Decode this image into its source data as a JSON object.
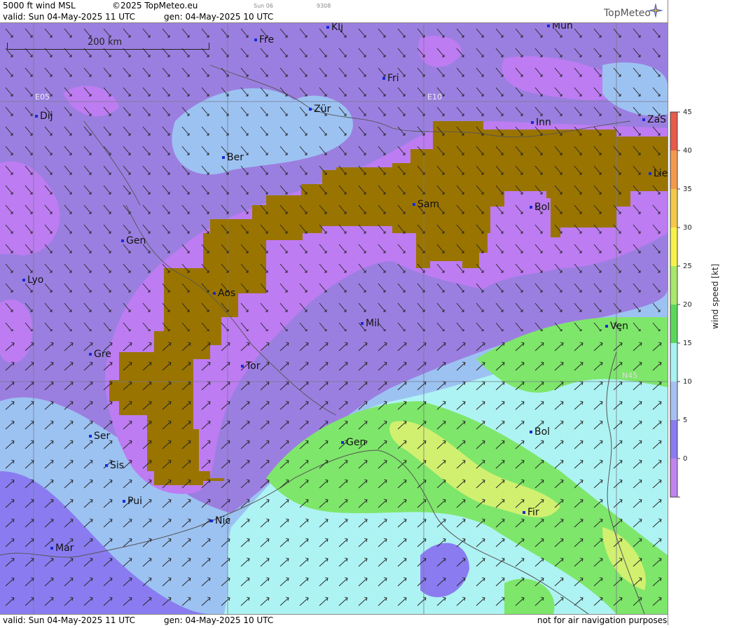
{
  "header": {
    "product": "5000 ft wind MSL",
    "copyright": "©2025 TopMeteo.eu",
    "valid_line": "valid:  Sun  04-May-2025  11 UTC",
    "gen_line": "gen: 04-May-2025 10 UTC",
    "day_tag": "Sun 06",
    "code_tag": "9308",
    "logo": "TopMeteo"
  },
  "footer": {
    "valid_line": "valid:  Sun  04-May-2025  11 UTC",
    "gen_line": "gen: 04-May-2025 10 UTC",
    "notice": "not for air navigation purposes"
  },
  "map": {
    "scale_label": "200 km",
    "grid_labels": {
      "e05": "E05",
      "e10": "E10",
      "n45": "N45"
    },
    "cities": [
      "Klj",
      "Mun",
      "Fre",
      "Fri",
      "Dij",
      "Zür",
      "Inn",
      "ZaS",
      "Ber",
      "Lie",
      "Sam",
      "Bol",
      "Gen",
      "Lyo",
      "Aos",
      "Mil",
      "Ven",
      "Gre",
      "Tor",
      "Ser",
      "Gen",
      "Bol",
      "Sis",
      "Pui",
      "Fir",
      "Nic",
      "Mar"
    ]
  },
  "legend": {
    "title": "wind speed [kt]",
    "ticks": [
      "45",
      "40",
      "35",
      "30",
      "25",
      "20",
      "15",
      "10",
      "5",
      "0"
    ],
    "colors": [
      "#e85a4a",
      "#f39a4a",
      "#f6c84a",
      "#f6f24a",
      "#a8e86a",
      "#5ad85a",
      "#a8f2f2",
      "#a6c0f4",
      "#8a7cf0",
      "#c084f0"
    ]
  },
  "colors": {
    "terrain": "#9a7400",
    "violet": "#bd7cf2",
    "purple": "#9b7fe0",
    "lightblue": "#9cc2f2",
    "cyan": "#aef3f3",
    "green": "#7ee66a",
    "yellowgreen": "#d2f070"
  }
}
